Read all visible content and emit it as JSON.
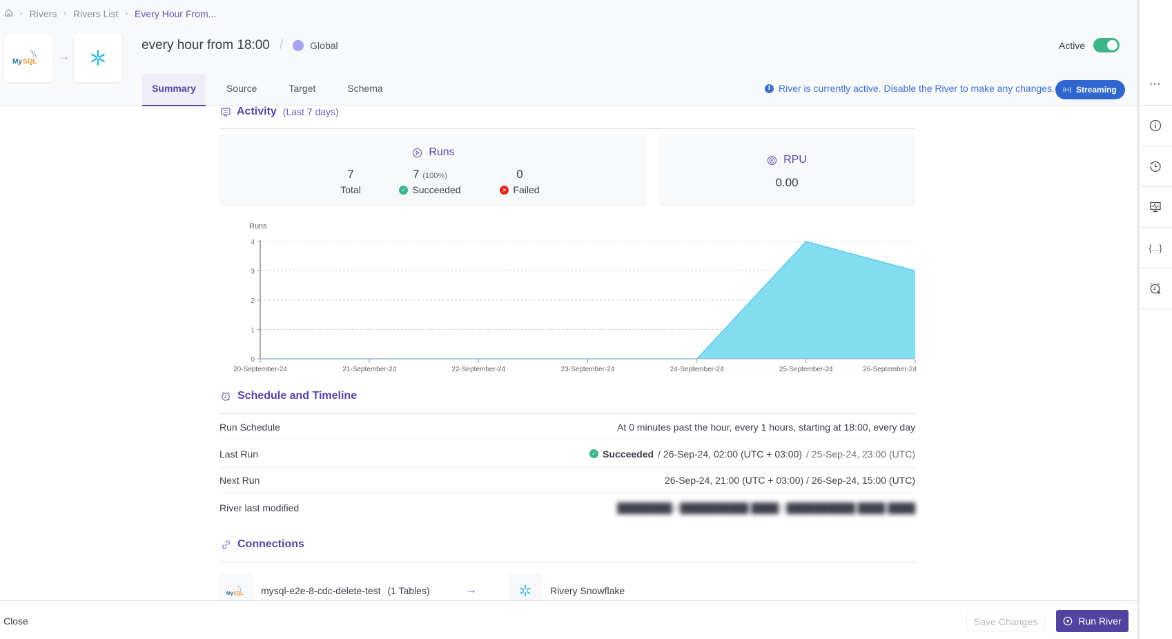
{
  "breadcrumb": {
    "home_icon": "home-icon",
    "items": [
      "Rivers",
      "Rivers List"
    ],
    "current": "Every Hour From..."
  },
  "header": {
    "source_logo": "MySQL",
    "target_logo": "snowflake-icon",
    "title": "every hour from 18:00",
    "separator": "/",
    "environment": "Global",
    "environment_color": "#a6a4f3",
    "active_label": "Active",
    "active_state": true,
    "notice": "River is currently active. Disable the River to make any changes.",
    "mode_badge": "Streaming"
  },
  "tabs": [
    {
      "label": "Summary",
      "active": true
    },
    {
      "label": "Source",
      "active": false
    },
    {
      "label": "Target",
      "active": false
    },
    {
      "label": "Schema",
      "active": false
    }
  ],
  "activity": {
    "title": "Activity",
    "subtitle": "(Last 7 days)",
    "runs": {
      "title": "Runs",
      "total": "7",
      "total_label": "Total",
      "succeeded": "7",
      "succeeded_pct": "(100%)",
      "succeeded_label": "Succeeded",
      "failed": "0",
      "failed_label": "Failed"
    },
    "rpu": {
      "title": "RPU",
      "value": "0.00"
    }
  },
  "chart_data": {
    "type": "area",
    "title": "",
    "ylabel": "Runs",
    "xlabel": "",
    "categories": [
      "20-September-24",
      "21-September-24",
      "22-September-24",
      "23-September-24",
      "24-September-24",
      "25-September-24",
      "26-September-24"
    ],
    "values": [
      0,
      0,
      0,
      0,
      0,
      4,
      3
    ],
    "ylim": [
      0,
      4
    ],
    "yticks": [
      0,
      1,
      2,
      3,
      4
    ],
    "grid": true,
    "fill_color": "#84dcf0",
    "line_color": "#5fcbe6"
  },
  "schedule": {
    "title": "Schedule and Timeline",
    "rows": [
      {
        "label": "Run Schedule",
        "value": "At 0 minutes past the hour, every 1 hours, starting at 18:00, every day"
      },
      {
        "label": "Last Run",
        "status": "Succeeded",
        "local": "/ 26-Sep-24, 02:00 (UTC + 03:00)",
        "utc": "/ 25-Sep-24, 23:00 (UTC)"
      },
      {
        "label": "Next Run",
        "value": "26-Sep-24, 21:00 (UTC + 03:00) / 26-Sep-24, 15:00 (UTC)"
      },
      {
        "label": "River last modified",
        "value": "[blurred]"
      }
    ]
  },
  "connections": {
    "title": "Connections",
    "source_name": "mysql-e2e-8-cdc-delete-test",
    "source_tables": "(1 Tables)",
    "target_name": "Rivery Snowflake"
  },
  "footer": {
    "close_label": "Close",
    "save_label": "Save Changes",
    "run_label": "Run River"
  },
  "rightbar": {
    "items": [
      "more-icon",
      "info-icon",
      "history-icon",
      "monitor-icon",
      "variables-icon",
      "alarm-icon"
    ],
    "more_label": "···",
    "variables_label": "{...}"
  }
}
